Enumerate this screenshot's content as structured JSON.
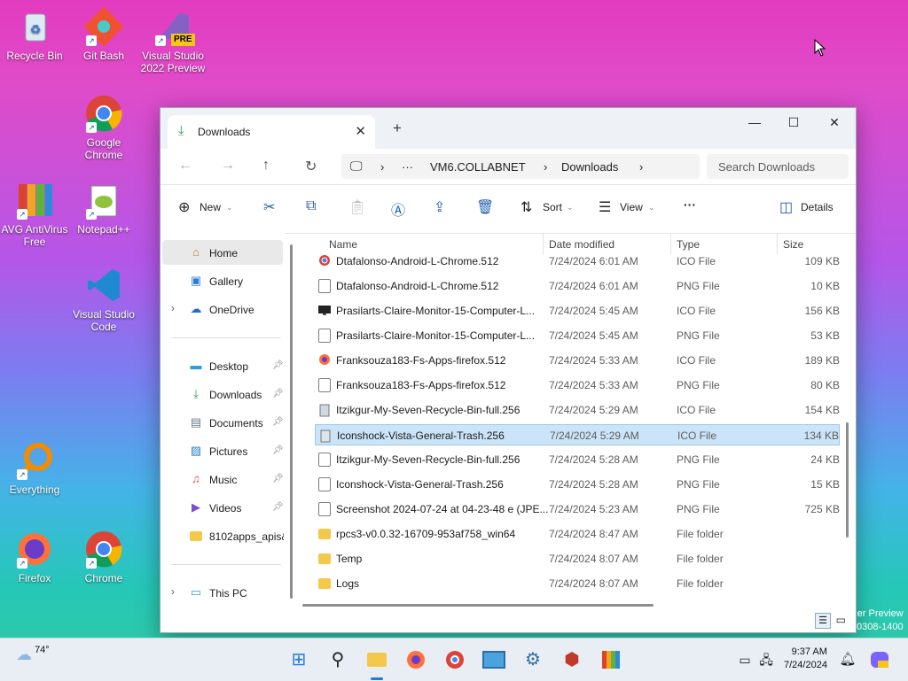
{
  "desktop": {
    "icons": [
      {
        "label": "Recycle Bin",
        "icon": "recycle-bin-icon"
      },
      {
        "label": "Git Bash",
        "icon": "git-bash-icon"
      },
      {
        "label": "Visual Studio 2022 Preview",
        "icon": "visual-studio-icon",
        "badge": "PRE"
      },
      {
        "label": "Google Chrome",
        "icon": "chrome-icon"
      },
      {
        "label": "AVG AntiVirus Free",
        "icon": "avg-icon"
      },
      {
        "label": "Notepad++",
        "icon": "notepadpp-icon"
      },
      {
        "label": "Visual Studio Code",
        "icon": "vscode-icon"
      },
      {
        "label": "Everything",
        "icon": "everything-icon"
      },
      {
        "label": "Firefox",
        "icon": "firefox-icon"
      },
      {
        "label": "Chrome",
        "icon": "chrome-icon"
      }
    ],
    "watermark_line1": "er Preview",
    "watermark_line2": "0308-1400"
  },
  "window": {
    "tab_title": "Downloads",
    "new_tab_glyph": "+",
    "controls": {
      "minimize": "—",
      "maximize": "☐",
      "close": "✕"
    },
    "address": {
      "segments": [
        "VM6.COLLABNET",
        "Downloads"
      ],
      "more": "···"
    },
    "search_placeholder": "Search Downloads",
    "toolbar": {
      "new": "New",
      "sort": "Sort",
      "view": "View",
      "more": "···",
      "details": "Details"
    }
  },
  "sidebar": {
    "items": [
      {
        "label": "Home",
        "icon": "home-icon"
      },
      {
        "label": "Gallery",
        "icon": "gallery-icon"
      },
      {
        "label": "OneDrive",
        "icon": "onedrive-icon"
      },
      {
        "label": "Desktop",
        "icon": "desktop-icon"
      },
      {
        "label": "Downloads",
        "icon": "downloads-icon"
      },
      {
        "label": "Documents",
        "icon": "documents-icon"
      },
      {
        "label": "Pictures",
        "icon": "pictures-icon"
      },
      {
        "label": "Music",
        "icon": "music-icon"
      },
      {
        "label": "Videos",
        "icon": "videos-icon"
      },
      {
        "label": "8102apps_apis&",
        "icon": "folder-icon"
      },
      {
        "label": "This PC",
        "icon": "this-pc-icon"
      }
    ]
  },
  "files": {
    "columns": [
      "Name",
      "Date modified",
      "Type",
      "Size"
    ],
    "rows": [
      {
        "name": "Dtafalonso-Android-L-Chrome.512",
        "date": "7/24/2024 6:01 AM",
        "type": "ICO File",
        "size": "109 KB"
      },
      {
        "name": "Dtafalonso-Android-L-Chrome.512",
        "date": "7/24/2024 6:01 AM",
        "type": "PNG File",
        "size": "10 KB"
      },
      {
        "name": "Prasilarts-Claire-Monitor-15-Computer-L...",
        "date": "7/24/2024 5:45 AM",
        "type": "ICO File",
        "size": "156 KB"
      },
      {
        "name": "Prasilarts-Claire-Monitor-15-Computer-L...",
        "date": "7/24/2024 5:45 AM",
        "type": "PNG File",
        "size": "53 KB"
      },
      {
        "name": "Franksouza183-Fs-Apps-firefox.512",
        "date": "7/24/2024 5:33 AM",
        "type": "ICO File",
        "size": "189 KB"
      },
      {
        "name": "Franksouza183-Fs-Apps-firefox.512",
        "date": "7/24/2024 5:33 AM",
        "type": "PNG File",
        "size": "80 KB"
      },
      {
        "name": "Itzikgur-My-Seven-Recycle-Bin-full.256",
        "date": "7/24/2024 5:29 AM",
        "type": "ICO File",
        "size": "154 KB"
      },
      {
        "name": "Iconshock-Vista-General-Trash.256",
        "date": "7/24/2024 5:29 AM",
        "type": "ICO File",
        "size": "134 KB"
      },
      {
        "name": "Itzikgur-My-Seven-Recycle-Bin-full.256",
        "date": "7/24/2024 5:28 AM",
        "type": "PNG File",
        "size": "24 KB"
      },
      {
        "name": "Iconshock-Vista-General-Trash.256",
        "date": "7/24/2024 5:28 AM",
        "type": "PNG File",
        "size": "15 KB"
      },
      {
        "name": "Screenshot 2024-07-24 at 04-23-48 e (JPE...",
        "date": "7/24/2024 5:23 AM",
        "type": "PNG File",
        "size": "725 KB"
      },
      {
        "name": "rpcs3-v0.0.32-16709-953af758_win64",
        "date": "7/24/2024 8:47 AM",
        "type": "File folder",
        "size": ""
      },
      {
        "name": "Temp",
        "date": "7/24/2024 8:07 AM",
        "type": "File folder",
        "size": ""
      },
      {
        "name": "Logs",
        "date": "7/24/2024 8:07 AM",
        "type": "File folder",
        "size": ""
      }
    ]
  },
  "taskbar": {
    "weather": "74°",
    "time": "9:37 AM",
    "date": "7/24/2024"
  }
}
